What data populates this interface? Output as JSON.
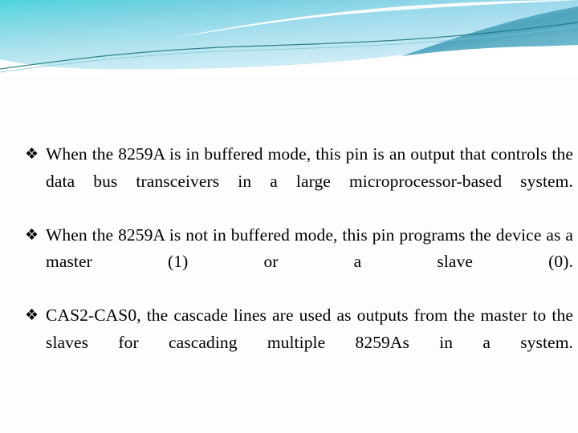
{
  "slide": {
    "background_color": "#fdfdfd",
    "banner": {
      "gradient_start": "#58d3dd",
      "gradient_mid": "#7fcfe3",
      "gradient_end": "#a9dced",
      "accent_dark": "#3f9ab5",
      "accent_line": "#1d7b86",
      "swoosh_color": "#ffffff"
    }
  },
  "body": {
    "bullet_glyph": "❖",
    "bullets": [
      {
        "text": "When the 8259A is in buffered mode, this pin is an output that controls the data bus transceivers in a large microprocessor-based system."
      },
      {
        "text": "When the 8259A is not in buffered mode, this pin programs the device as a master (1) or a slave (0)."
      },
      {
        "text": "CAS2-CAS0, the cascade lines are used as outputs from the master to the slaves for cascading multiple 8259As in a system."
      }
    ]
  }
}
